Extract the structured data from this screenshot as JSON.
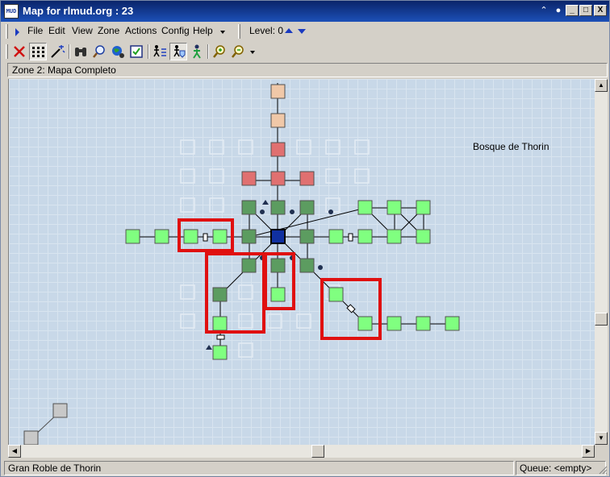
{
  "window": {
    "title": "Map for rlmud.org : 23",
    "app_icon_text": "MUD",
    "minimize": "_",
    "maximize": "□",
    "close": "X"
  },
  "menu": {
    "items": [
      {
        "id": "file",
        "label": "File"
      },
      {
        "id": "edit",
        "label": "Edit"
      },
      {
        "id": "view",
        "label": "View"
      },
      {
        "id": "zone",
        "label": "Zone"
      },
      {
        "id": "actions",
        "label": "Actions"
      },
      {
        "id": "config",
        "label": "Config"
      },
      {
        "id": "help",
        "label": "Help"
      }
    ],
    "level_label": "Level: 0"
  },
  "toolbar": {
    "tools": [
      "delete-icon",
      "grid-icon",
      "wand-icon",
      "binoculars-icon",
      "magnifier-icon",
      "globe-icon",
      "checkbox-icon",
      "walker-list-icon",
      "shield-walker-icon",
      "walker-icon",
      "zoom-in-icon",
      "zoom-out-icon"
    ]
  },
  "zone_header": "Zone 2: Mapa Completo",
  "map": {
    "area_label": "Bosque de Thorin",
    "colors": {
      "light_green": "#80ff80",
      "dark_green": "#5c9c60",
      "red": "#e07070",
      "peach": "#f0c8a8",
      "current": "#1030a0",
      "highlight": "#e01010",
      "gray": "#c8c8c8"
    }
  },
  "status": {
    "location": "Gran Roble de Thorin",
    "queue": "Queue: <empty>"
  }
}
